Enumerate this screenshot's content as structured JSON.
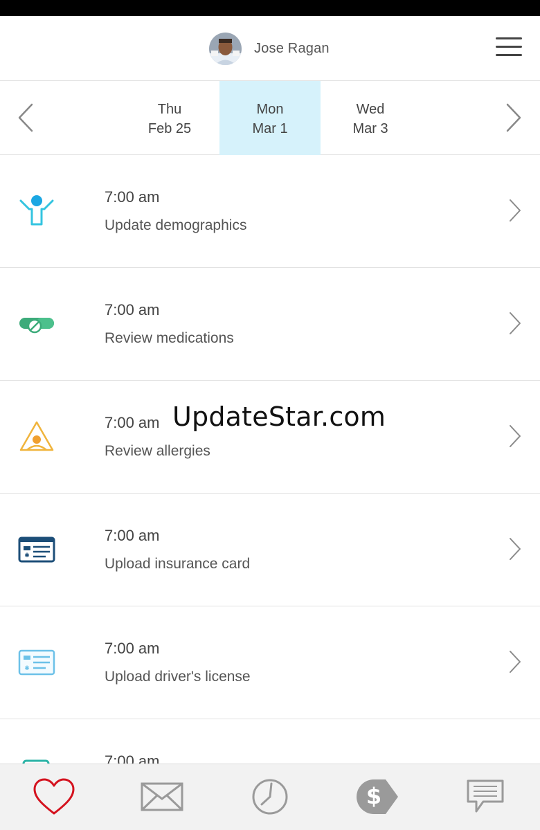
{
  "header": {
    "user_name": "Jose Ragan",
    "avatar_icon": "user-avatar",
    "menu_icon": "hamburger-menu-icon"
  },
  "date_strip": {
    "days": [
      {
        "weekday": "Thu",
        "date": "Feb 25",
        "selected": false
      },
      {
        "weekday": "Mon",
        "date": "Mar 1",
        "selected": true
      },
      {
        "weekday": "Wed",
        "date": "Mar 3",
        "selected": false
      }
    ],
    "selected_color": "#d6f2fb"
  },
  "tasks": [
    {
      "time": "7:00 am",
      "title": "Update demographics",
      "icon": "person-raised-arms-icon",
      "color": "#29b9e0"
    },
    {
      "time": "7:00 am",
      "title": "Review medications",
      "icon": "pill-capsule-icon",
      "color": "#3cab7a"
    },
    {
      "time": "7:00 am",
      "title": "Review allergies",
      "icon": "warning-triangle-icon",
      "color": "#f0b43c"
    },
    {
      "time": "7:00 am",
      "title": "Upload insurance card",
      "icon": "insurance-card-icon",
      "color": "#1c4e78"
    },
    {
      "time": "7:00 am",
      "title": "Upload driver's license",
      "icon": "id-card-icon",
      "color": "#6cc1e8"
    },
    {
      "time": "7:00 am",
      "title": "",
      "icon": "card-icon",
      "color": "#2ab3a6"
    }
  ],
  "watermark": "UpdateStar.com",
  "tab_bar": {
    "tabs": [
      {
        "icon": "heart-icon",
        "active": true,
        "color": "#d4121e"
      },
      {
        "icon": "envelope-icon",
        "active": false,
        "color": "#9a9a9a"
      },
      {
        "icon": "clock-icon",
        "active": false,
        "color": "#9a9a9a"
      },
      {
        "icon": "dollar-tag-icon",
        "active": false,
        "color": "#9a9a9a"
      },
      {
        "icon": "chat-bubble-icon",
        "active": false,
        "color": "#9a9a9a"
      }
    ]
  }
}
